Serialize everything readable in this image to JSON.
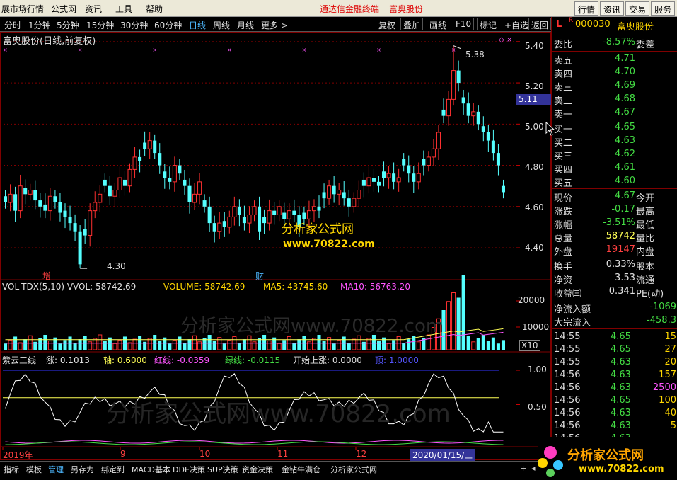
{
  "menubar": {
    "items": [
      "展市场行情",
      "公式网",
      "资讯",
      "工具",
      "帮助"
    ],
    "brand": "通达信金融终端",
    "stock": "富奥股份",
    "right_buttons": [
      "行情",
      "资讯",
      "交易",
      "服务"
    ]
  },
  "toolbar": {
    "periods": [
      "分时",
      "1分钟",
      "5分钟",
      "15分钟",
      "30分钟",
      "60分钟",
      "日线",
      "周线",
      "月线",
      "更多 >"
    ],
    "active_period": "日线",
    "buttons": [
      "复权",
      "叠加",
      "画线",
      "F10",
      "标记",
      "+自选",
      "返回"
    ]
  },
  "chart": {
    "title": "富奥股份(日线,前复权)",
    "high_label": "5.38",
    "low_label": "4.30",
    "event_zeng": "增",
    "event_cai": "财",
    "watermark_top": "分析家公式网",
    "watermark_url": "www.70822.com",
    "watermark_mid": "分析家公式网www.70822.com",
    "watermark_bottom": "分析家公式网www.70822.com",
    "price_axis": [
      "5.40",
      "5.20",
      "5.00",
      "4.80",
      "4.60",
      "4.40"
    ],
    "current_price_tag": "5.11",
    "vol_header": {
      "name": "VOL-TDX(5,10) VVOL: 58742.69",
      "volume": "VOLUME: 58742.69",
      "ma5": "MA5: 43745.60",
      "ma10": "MA10: 56763.20"
    },
    "vol_axis": [
      "20000",
      "10000"
    ],
    "vol_unit": "X10",
    "osc_header": {
      "name": "紫云三线",
      "zhang": "涨: 0.1013",
      "zhou": "轴: 0.6000",
      "hong": "红线: -0.0359",
      "lv": "绿线: -0.0115",
      "kaishi": "开始上涨: 0.0000",
      "ding": "顶: 1.0000"
    },
    "osc_axis": [
      "1.00",
      "0.50"
    ],
    "date_axis": [
      "2019年",
      "9",
      "10",
      "11",
      "12"
    ],
    "cursor_date": "2020/01/15/三"
  },
  "chart_data": {
    "type": "candlestick",
    "title": "富奥股份(日线,前复权)",
    "close": [
      4.62,
      4.66,
      4.58,
      4.7,
      4.66,
      4.68,
      4.63,
      4.6,
      4.58,
      4.65,
      4.62,
      4.57,
      4.55,
      4.52,
      4.48,
      4.32,
      4.46,
      4.58,
      4.62,
      4.66,
      4.7,
      4.65,
      4.68,
      4.74,
      4.7,
      4.78,
      4.84,
      4.82,
      4.88,
      4.92,
      4.86,
      4.8,
      4.74,
      4.72,
      4.8,
      4.76,
      4.7,
      4.62,
      4.66,
      4.72,
      4.6,
      4.52,
      4.48,
      4.52,
      4.5,
      4.55,
      4.6,
      4.56,
      4.52,
      4.56,
      4.6,
      4.48,
      4.52,
      4.58,
      4.56,
      4.6,
      4.54,
      4.58,
      4.56,
      4.5,
      4.54,
      4.58,
      4.6,
      4.58,
      4.64,
      4.7,
      4.66,
      4.68,
      4.64,
      4.6,
      4.64,
      4.68,
      4.7,
      4.74,
      4.72,
      4.7,
      4.74,
      4.76,
      4.72,
      4.74,
      4.8,
      4.76,
      4.72,
      4.76,
      4.8,
      4.84,
      4.88,
      4.96,
      5.04,
      5.12,
      5.26,
      5.2,
      5.1,
      5.04,
      5.06,
      5.0,
      4.96,
      4.92,
      4.86,
      4.8,
      4.67
    ],
    "high_point": 5.38,
    "low_point": 4.3,
    "vvol": 58742.69,
    "volume": 58742.69,
    "ma5": 43745.6,
    "ma10": 56763.2,
    "zhang": 0.1013,
    "zhou": 0.6,
    "hong": -0.0359,
    "lv": -0.0115,
    "kaishi": 0.0,
    "ding": 1.0,
    "colors": {
      "up": "#ff3030",
      "down": "#54ffff",
      "ma5": "#ffff55",
      "ma10": "#ff55ff"
    }
  },
  "quote": {
    "code": "000030",
    "name": "富奥股份",
    "weibi": {
      "k": "委比",
      "v": "-8.57%",
      "r": "委差"
    },
    "asks": [
      {
        "k": "卖五",
        "v": "4.71"
      },
      {
        "k": "卖四",
        "v": "4.70"
      },
      {
        "k": "卖三",
        "v": "4.69"
      },
      {
        "k": "卖二",
        "v": "4.68"
      },
      {
        "k": "卖一",
        "v": "4.67"
      }
    ],
    "bids": [
      {
        "k": "买一",
        "v": "4.65"
      },
      {
        "k": "买二",
        "v": "4.63"
      },
      {
        "k": "买三",
        "v": "4.62"
      },
      {
        "k": "买四",
        "v": "4.61"
      },
      {
        "k": "买五",
        "v": "4.60"
      }
    ],
    "stats": [
      {
        "k": "现价",
        "v": "4.67",
        "r": "今开",
        "c": "#44dd44"
      },
      {
        "k": "涨跌",
        "v": "-0.17",
        "r": "最高",
        "c": "#44dd44"
      },
      {
        "k": "涨幅",
        "v": "-3.51%",
        "r": "最低",
        "c": "#44dd44"
      },
      {
        "k": "总量",
        "v": "58742",
        "r": "量比",
        "c": "#ffff55"
      },
      {
        "k": "外盘",
        "v": "19147",
        "r": "内盘",
        "c": "#ff4040"
      }
    ],
    "finance": [
      {
        "k": "换手",
        "v": "0.33%",
        "r": "股本"
      },
      {
        "k": "净资",
        "v": "3.53",
        "r": "流通"
      },
      {
        "k": "收益㈢",
        "v": "0.341",
        "r": "PE(动)"
      }
    ],
    "flow": [
      {
        "k": "净流入额",
        "v": "-1069"
      },
      {
        "k": "大宗流入",
        "v": "-458.3"
      }
    ],
    "ticks": [
      {
        "t": "14:55",
        "p": "4.65",
        "q": "15"
      },
      {
        "t": "14:55",
        "p": "4.65",
        "q": "27"
      },
      {
        "t": "14:55",
        "p": "4.63",
        "q": "20"
      },
      {
        "t": "14:56",
        "p": "4.63",
        "q": "157"
      },
      {
        "t": "14:56",
        "p": "4.63",
        "q": "2500"
      },
      {
        "t": "14:56",
        "p": "4.65",
        "q": "100"
      },
      {
        "t": "14:56",
        "p": "4.63",
        "q": "40"
      },
      {
        "t": "14:56",
        "p": "4.63",
        "q": "5"
      },
      {
        "t": "14:56",
        "p": "4.63",
        "q": ""
      }
    ]
  },
  "tabs": {
    "items": [
      "指标",
      "模板",
      "管理",
      "另存为",
      "绑定到",
      "MACD基本",
      "DDE决策",
      "SUP决策",
      "资金决策",
      "金钻牛满仓",
      "分析家公式网"
    ],
    "active": "管理"
  },
  "logo": {
    "cn": "分析家公式网",
    "url": "www.70822.com"
  }
}
